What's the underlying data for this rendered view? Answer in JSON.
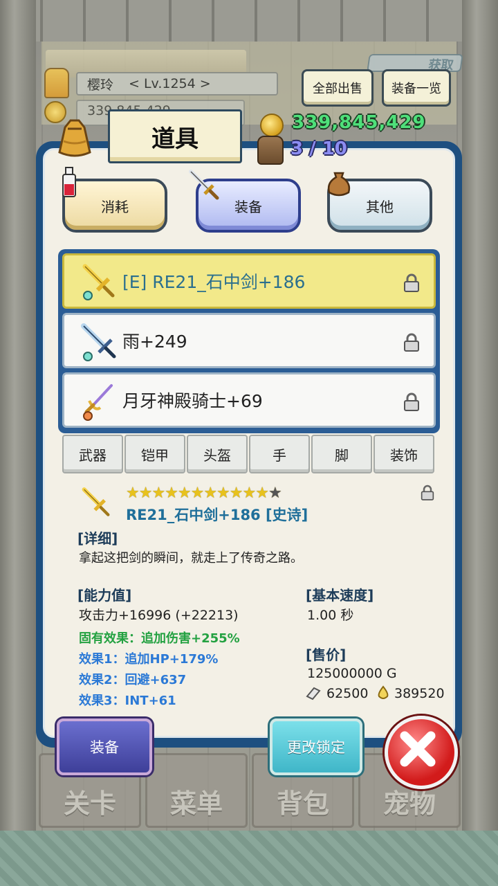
{
  "player": {
    "name": "樱玲",
    "level": "< Lv.1254 >",
    "gold_ghost": "339,845,429"
  },
  "top_buttons": {
    "sell_all": "全部出售",
    "equip_list": "装备一览",
    "get": "获取"
  },
  "header": {
    "title": "道具",
    "gold": "339,845,429",
    "bag_count": "3 / 10"
  },
  "categories": [
    {
      "label": "消耗",
      "icon": "potion-icon"
    },
    {
      "label": "装备",
      "icon": "sword-icon",
      "selected": true
    },
    {
      "label": "其他",
      "icon": "pouch-icon"
    }
  ],
  "items": [
    {
      "name": "[E] RE21_石中剑+186",
      "selected": true,
      "icon": "golden-sword-icon"
    },
    {
      "name": "雨+249",
      "selected": false,
      "icon": "blue-sword-icon"
    },
    {
      "name": "月牙神殿骑士+69",
      "selected": false,
      "icon": "rapier-icon"
    }
  ],
  "filters": [
    "武器",
    "铠甲",
    "头盔",
    "手",
    "脚",
    "装饰"
  ],
  "detail": {
    "stars_gold": "★★★★★★★★★★★",
    "stars_grey": "★",
    "name": "RE21_石中剑+186 [史诗]",
    "detail_title": "[详细]",
    "description": "拿起这把剑的瞬间，就走上了传奇之路。",
    "ability_title": "[能力值]",
    "attack": "攻击力+16996 (+22213)",
    "inherent": "固有效果：追加伤害+255%",
    "effect1": "效果1：追加HP+179%",
    "effect2": "效果2：回避+637",
    "effect3": "效果3：INT+61",
    "speed_title": "[基本速度]",
    "speed": "1.00 秒",
    "price_title": "[售价]",
    "price": "125000000 G",
    "stone": "62500",
    "drop": "389520"
  },
  "actions": {
    "equip": "装备",
    "change_lock": "更改锁定"
  },
  "bottom_nav": [
    "关卡",
    "菜单",
    "背包",
    "宠物"
  ],
  "colors": {
    "panel_border": "#1d4f80",
    "selected_item": "#f2e98a",
    "gold_text": "#4fe07a",
    "effect_blue": "#2b79d6",
    "effect_green": "#23a141"
  }
}
